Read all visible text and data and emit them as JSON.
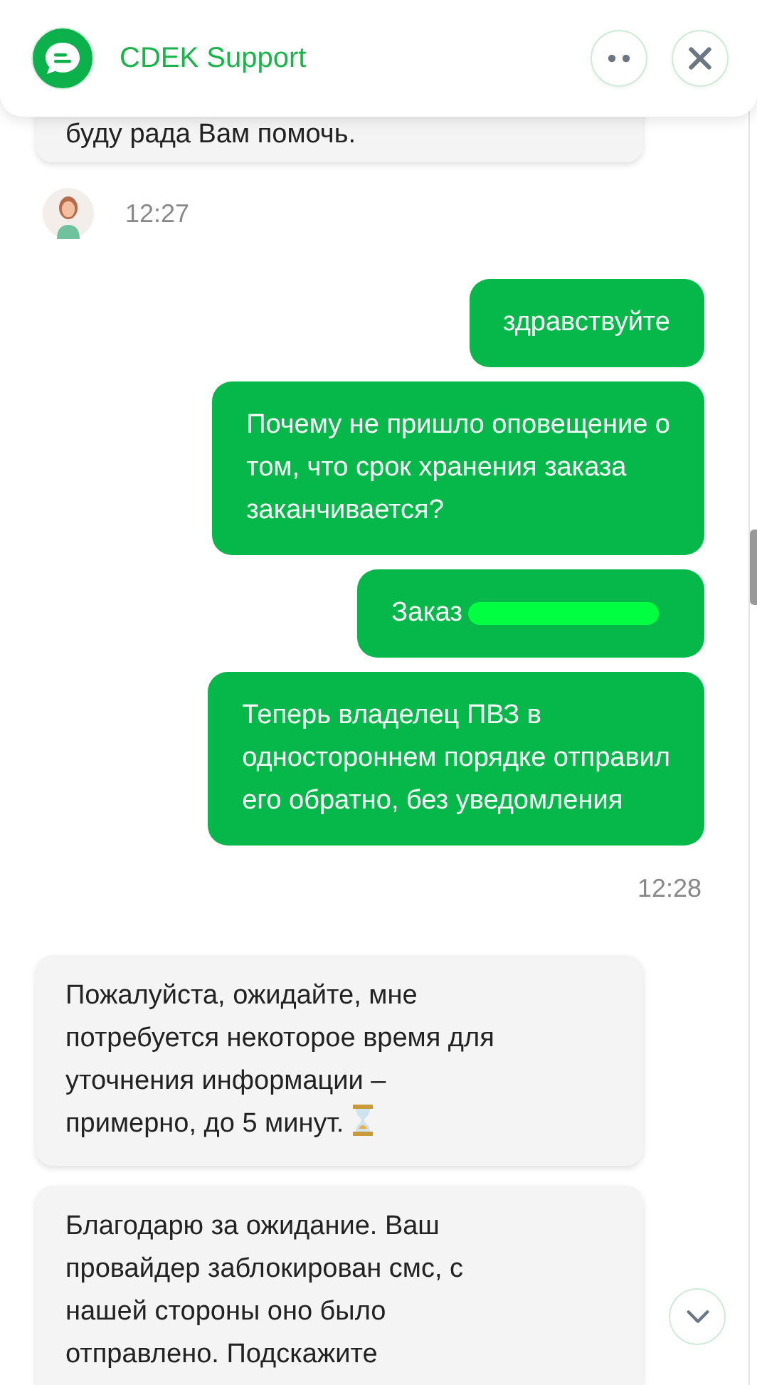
{
  "header": {
    "title": "CDEK Support"
  },
  "messages": [
    {
      "kind": "incoming",
      "text": "буду рада Вам помочь."
    },
    {
      "kind": "agent_time",
      "text": "12:27"
    },
    {
      "kind": "outgoing",
      "text": "здравствуйте"
    },
    {
      "kind": "outgoing",
      "text": "Почему не пришло оповещение о\nтом, что срок хранения заказа\nзаканчивается?"
    },
    {
      "kind": "outgoing",
      "text": "Заказ",
      "redacted": true
    },
    {
      "kind": "outgoing",
      "text": "Теперь владелец ПВЗ в\nодностороннем порядке отправил\nего обратно, без уведомления"
    },
    {
      "kind": "time",
      "text": "12:28"
    },
    {
      "kind": "incoming",
      "text": "Пожалуйста, ожидайте, мне\nпотребуется некоторое время для\nуточнения информации –\nпримерно, до 5 минут.",
      "hourglass": true
    },
    {
      "kind": "incoming",
      "text": "Благодарю за ожидание. Ваш\nпровайдер заблокирован смс, с\nнашей стороны оно было\nотправлено. Подскажите"
    }
  ]
}
